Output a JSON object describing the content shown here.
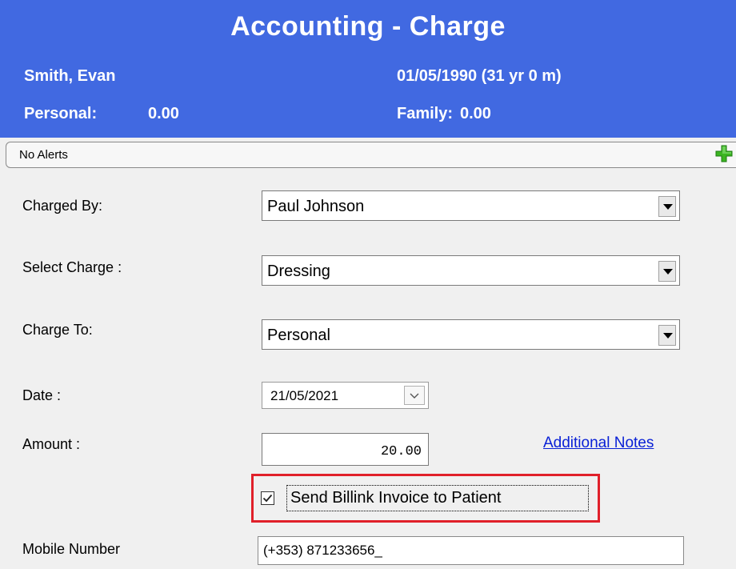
{
  "header": {
    "title": "Accounting - Charge",
    "patient_name": "Smith, Evan",
    "dob": "01/05/1990 (31 yr 0 m)",
    "personal_label": "Personal:",
    "personal_value": "0.00",
    "family_label": "Family:",
    "family_value": "0.00",
    "background": "#4169e1"
  },
  "alerts": {
    "text": "No Alerts",
    "add_icon": "green-plus-icon"
  },
  "form": {
    "charged_by": {
      "label": "Charged By:",
      "value": "Paul Johnson"
    },
    "select_charge": {
      "label": "Select Charge :",
      "value": "Dressing"
    },
    "charge_to": {
      "label": "Charge To:",
      "value": "Personal"
    },
    "date": {
      "label": "Date :",
      "value": "21/05/2021"
    },
    "amount": {
      "label": "Amount :",
      "value": "20.00"
    },
    "additional_notes": "Additional Notes",
    "send_invoice": {
      "label": "Send Billink Invoice to Patient",
      "checked": true
    },
    "mobile": {
      "label": "Mobile Number",
      "value": "(+353) 871233656_"
    }
  },
  "colors": {
    "highlight_border": "#e0202a",
    "link": "#0a21d6"
  }
}
